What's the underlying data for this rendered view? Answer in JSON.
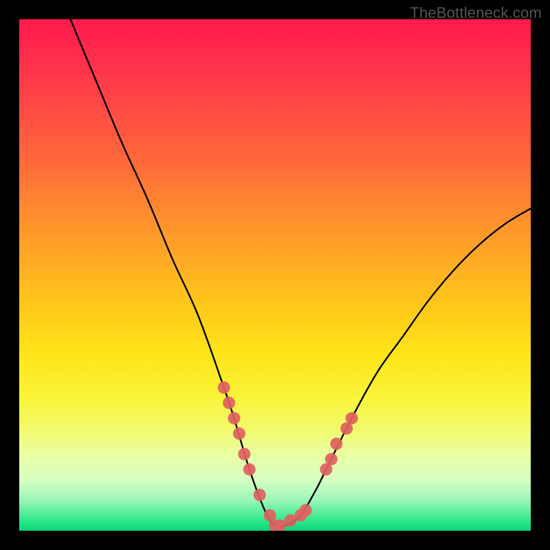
{
  "watermark": "TheBottleneck.com",
  "chart_data": {
    "type": "line",
    "title": "",
    "xlabel": "",
    "ylabel": "",
    "xlim": [
      0,
      100
    ],
    "ylim": [
      0,
      100
    ],
    "series": [
      {
        "name": "bottleneck-curve",
        "x": [
          10,
          15,
          20,
          25,
          30,
          35,
          40,
          42,
          45,
          48,
          50,
          52,
          55,
          58,
          60,
          65,
          70,
          75,
          80,
          85,
          90,
          95,
          100
        ],
        "values": [
          100,
          88,
          76,
          65,
          53,
          42,
          28,
          22,
          12,
          4,
          1,
          1,
          3,
          8,
          12,
          22,
          31,
          38,
          45,
          51,
          56,
          60,
          63
        ]
      }
    ],
    "markers": {
      "name": "highlight-points",
      "color": "#e0615f",
      "x": [
        40,
        41,
        42,
        43,
        44,
        45,
        47,
        49,
        50,
        51,
        53,
        55,
        56,
        60,
        61,
        62,
        64,
        65
      ],
      "values": [
        28,
        25,
        22,
        19,
        15,
        12,
        7,
        3,
        1,
        1,
        2,
        3,
        4,
        12,
        14,
        17,
        20,
        22
      ]
    }
  },
  "colors": {
    "curve_stroke": "#000000",
    "marker_fill": "#e0615f"
  }
}
